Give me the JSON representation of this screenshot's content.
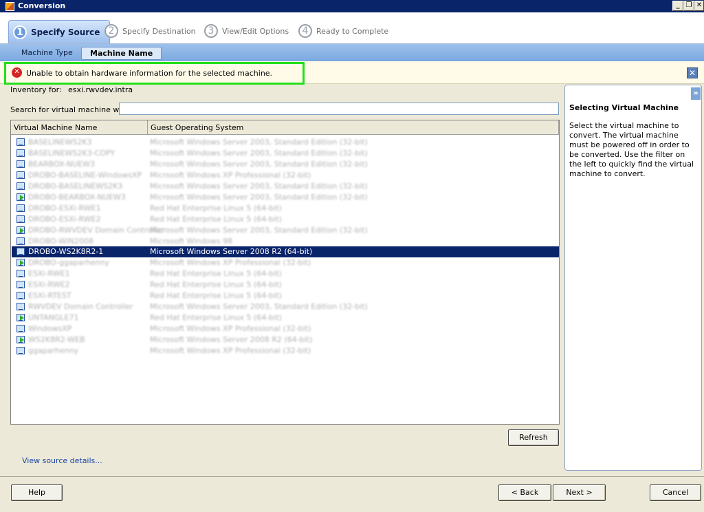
{
  "window": {
    "title": "Conversion",
    "minimize": "_",
    "restore": "❐",
    "close": "✕"
  },
  "steps": [
    {
      "num": "1",
      "label": "Specify Source"
    },
    {
      "num": "2",
      "label": "Specify Destination"
    },
    {
      "num": "3",
      "label": "View/Edit Options"
    },
    {
      "num": "4",
      "label": "Ready to Complete"
    }
  ],
  "subtabs": [
    {
      "label": "Machine Type"
    },
    {
      "label": "Machine Name"
    }
  ],
  "error": {
    "icon": "✕",
    "message": "Unable to obtain hardware information for the selected machine.",
    "close": "✕"
  },
  "inventory": {
    "label": "Inventory for:",
    "value": "esxi.rwvdev.intra"
  },
  "search": {
    "label": "Search for virtual machine with:",
    "value": "",
    "placeholder": ""
  },
  "table": {
    "columns": [
      "Virtual Machine Name",
      "Guest Operating System"
    ],
    "rows": [
      {
        "name": "BASELINEWS2K3",
        "os": "Microsoft Windows Server 2003, Standard Edition (32-bit)"
      },
      {
        "name": "BASELINEWS2K3-COPY",
        "os": "Microsoft Windows Server 2003, Standard Edition (32-bit)"
      },
      {
        "name": "BEARBOX-NUEW3",
        "os": "Microsoft Windows Server 2003, Standard Edition (32-bit)"
      },
      {
        "name": "DROBO-BASELINE-WindowsXP",
        "os": "Microsoft Windows XP Professional (32-bit)"
      },
      {
        "name": "DROBO-BASELINEWS2K3",
        "os": "Microsoft Windows Server 2003, Standard Edition (32-bit)"
      },
      {
        "name": "DROBO-BEARBOX-NUEW3",
        "os": "Microsoft Windows Server 2003, Standard Edition (32-bit)"
      },
      {
        "name": "DROBO-ESXi-RWE1",
        "os": "Red Hat Enterprise Linux 5 (64-bit)"
      },
      {
        "name": "DROBO-ESXi-RWE2",
        "os": "Red Hat Enterprise Linux 5 (64-bit)"
      },
      {
        "name": "DROBO-RWVDEV Domain Controller",
        "os": "Microsoft Windows Server 2003, Standard Edition (32-bit)"
      },
      {
        "name": "DROBO-WIN2008",
        "os": "Microsoft Windows 98"
      },
      {
        "name": "DROBO-WS2K8R2-1",
        "os": "Microsoft Windows Server 2008 R2 (64-bit)"
      },
      {
        "name": "DROBO-ggaparhenny",
        "os": "Microsoft Windows XP Professional (32-bit)"
      },
      {
        "name": "ESXi-RWE1",
        "os": "Red Hat Enterprise Linux 5 (64-bit)"
      },
      {
        "name": "ESXi-RWE2",
        "os": "Red Hat Enterprise Linux 5 (64-bit)"
      },
      {
        "name": "ESXi-RTEST",
        "os": "Red Hat Enterprise Linux 5 (64-bit)"
      },
      {
        "name": "RWVDEV Domain Controller",
        "os": "Microsoft Windows Server 2003, Standard Edition (32-bit)"
      },
      {
        "name": "UNTANGLE71",
        "os": "Red Hat Enterprise Linux 5 (64-bit)"
      },
      {
        "name": "WindowsXP",
        "os": "Microsoft Windows XP Professional (32-bit)"
      },
      {
        "name": "WS2K8R2-WEB",
        "os": "Microsoft Windows Server 2008 R2 (64-bit)"
      },
      {
        "name": "ggaparhenny",
        "os": "Microsoft Windows XP Professional (32-bit)"
      }
    ]
  },
  "buttons": {
    "refresh": "Refresh",
    "help": "Help",
    "back": "< Back",
    "next": "Next >",
    "cancel": "Cancel"
  },
  "link": {
    "view_details": "View source details..."
  },
  "side": {
    "toggle": "»",
    "title": "Selecting Virtual Machine",
    "text": "Select the virtual machine to convert. The virtual machine must be powered off in order to be converted. Use the filter on the left to quickly find the virtual machine to convert."
  }
}
